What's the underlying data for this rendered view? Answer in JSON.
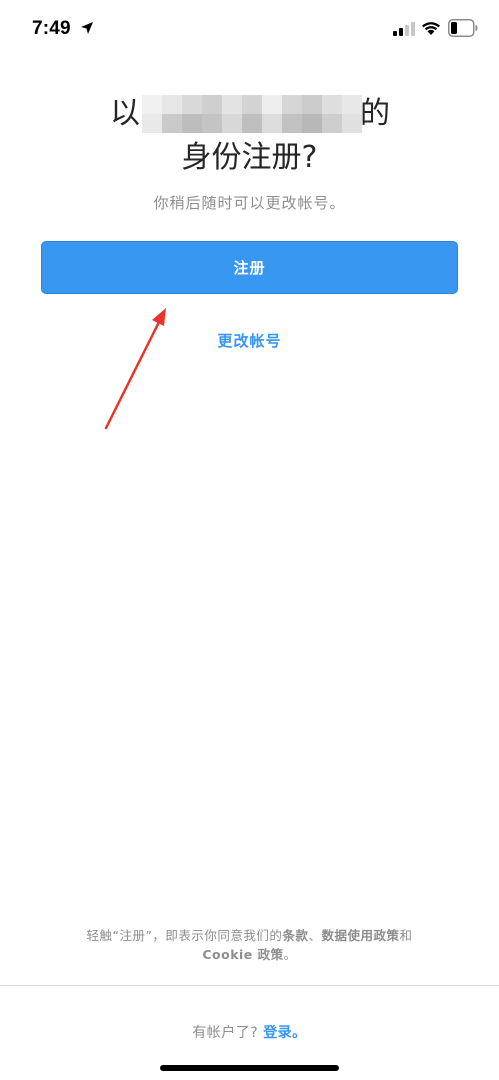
{
  "status_bar": {
    "time": "7:49",
    "icons": [
      "location-arrow-icon",
      "cellular-signal-icon",
      "wifi-icon",
      "battery-icon"
    ]
  },
  "title": {
    "prefix": "以",
    "suffix": "的",
    "line2": "身份注册?"
  },
  "subtitle": "你稍后随时可以更改帐号。",
  "signup_button": "注册",
  "change_account_link": "更改帐号",
  "terms": {
    "text_before": "轻触“注册”，即表示你同意我们的",
    "terms_link": "条款",
    "separator": "、",
    "data_policy_link": "数据使用政策",
    "and": "和",
    "cookie_policy_link": "Cookie 政策",
    "end": "。"
  },
  "footer": {
    "question": "有帐户了?",
    "login_link": "登录。"
  },
  "colors": {
    "accent": "#3897f0",
    "text_secondary": "#8e8e8e",
    "text_primary": "#262626",
    "annotation_arrow": "#e8352b"
  }
}
